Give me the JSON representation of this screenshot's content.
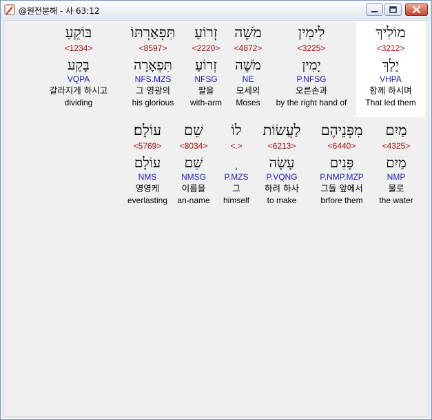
{
  "window": {
    "title": "@원전분해 - 사 63:12",
    "icons": {
      "app": "app-logo-icon",
      "minimize": "minimize-icon",
      "maximize": "maximize-icon",
      "close": "close-icon"
    },
    "colors": {
      "strong": "#a01010",
      "morph": "#2020c0",
      "text": "#000000"
    }
  },
  "verse": {
    "rows": [
      {
        "words": [
          {
            "hebrew": "מוֹלִיךְ",
            "strong": "<3212>",
            "lemma": "יָלַךְ",
            "morph": "VHPA",
            "korean": "함께 하시며",
            "english": "That led them",
            "highlight": true
          },
          {
            "hebrew": "לִימִין",
            "strong": "<3225>",
            "lemma": "יָמִין",
            "morph": "P.NFSG",
            "korean": "오른손과",
            "english": "by the right hand of",
            "highlight": false
          },
          {
            "hebrew": "מֹשֶׁה",
            "strong": "<4872>",
            "lemma": "מֹשֶׁה",
            "morph": "NE",
            "korean": "모세의",
            "english": "Moses",
            "highlight": false
          },
          {
            "hebrew": "זְרוֹעַ",
            "strong": "<2220>",
            "lemma": "זְרוֹעַ",
            "morph": "NFSG",
            "korean": "팔을",
            "english": "with-arm",
            "highlight": false
          },
          {
            "hebrew": "תִּפְאַרְתּוֹ",
            "strong": "<8597>",
            "lemma": "תִּפְאָרָה",
            "morph": "NFS.MZS",
            "korean": "그 영광의",
            "english": "his glorious",
            "highlight": false
          },
          {
            "hebrew": "בּוֹקֵעַ",
            "strong": "<1234>",
            "lemma": "בָּקַע",
            "morph": "VQPA",
            "korean": "갈라지게 하시고",
            "english": "dividing",
            "highlight": false
          }
        ]
      },
      {
        "words": [
          {
            "hebrew": "מַיִם",
            "strong": "<4325>",
            "lemma": "מַיִם",
            "morph": "NMP",
            "korean": "물로",
            "english": "the water",
            "highlight": false
          },
          {
            "hebrew": "מִפְּנֵיהֶם",
            "strong": "<6440>",
            "lemma": "פָּנִים",
            "morph": "P.NMP.MZP",
            "korean": "그들 앞에서",
            "english": "brfore them",
            "highlight": false
          },
          {
            "hebrew": "לַעֲשׂוֹת",
            "strong": "<6213>",
            "lemma": "עָשָׂה",
            "morph": "P.VQNG",
            "korean": "하려 하사",
            "english": "to make",
            "highlight": false
          },
          {
            "hebrew": "לוֹ",
            "strong": "<.>",
            "lemma": "ְ",
            "morph": "P.MZS",
            "korean": "그",
            "english": "himself",
            "highlight": false
          },
          {
            "hebrew": "שֵׁם",
            "strong": "<8034>",
            "lemma": "שֵׁם",
            "morph": "NMSG",
            "korean": "이름을",
            "english": "an-name",
            "highlight": false
          },
          {
            "hebrew": "עוֹלָם׃",
            "strong": "<5769>",
            "lemma": "עוֹלָם",
            "morph": "NMS",
            "korean": "영영케",
            "english": "everlasting",
            "highlight": false
          }
        ]
      }
    ]
  }
}
